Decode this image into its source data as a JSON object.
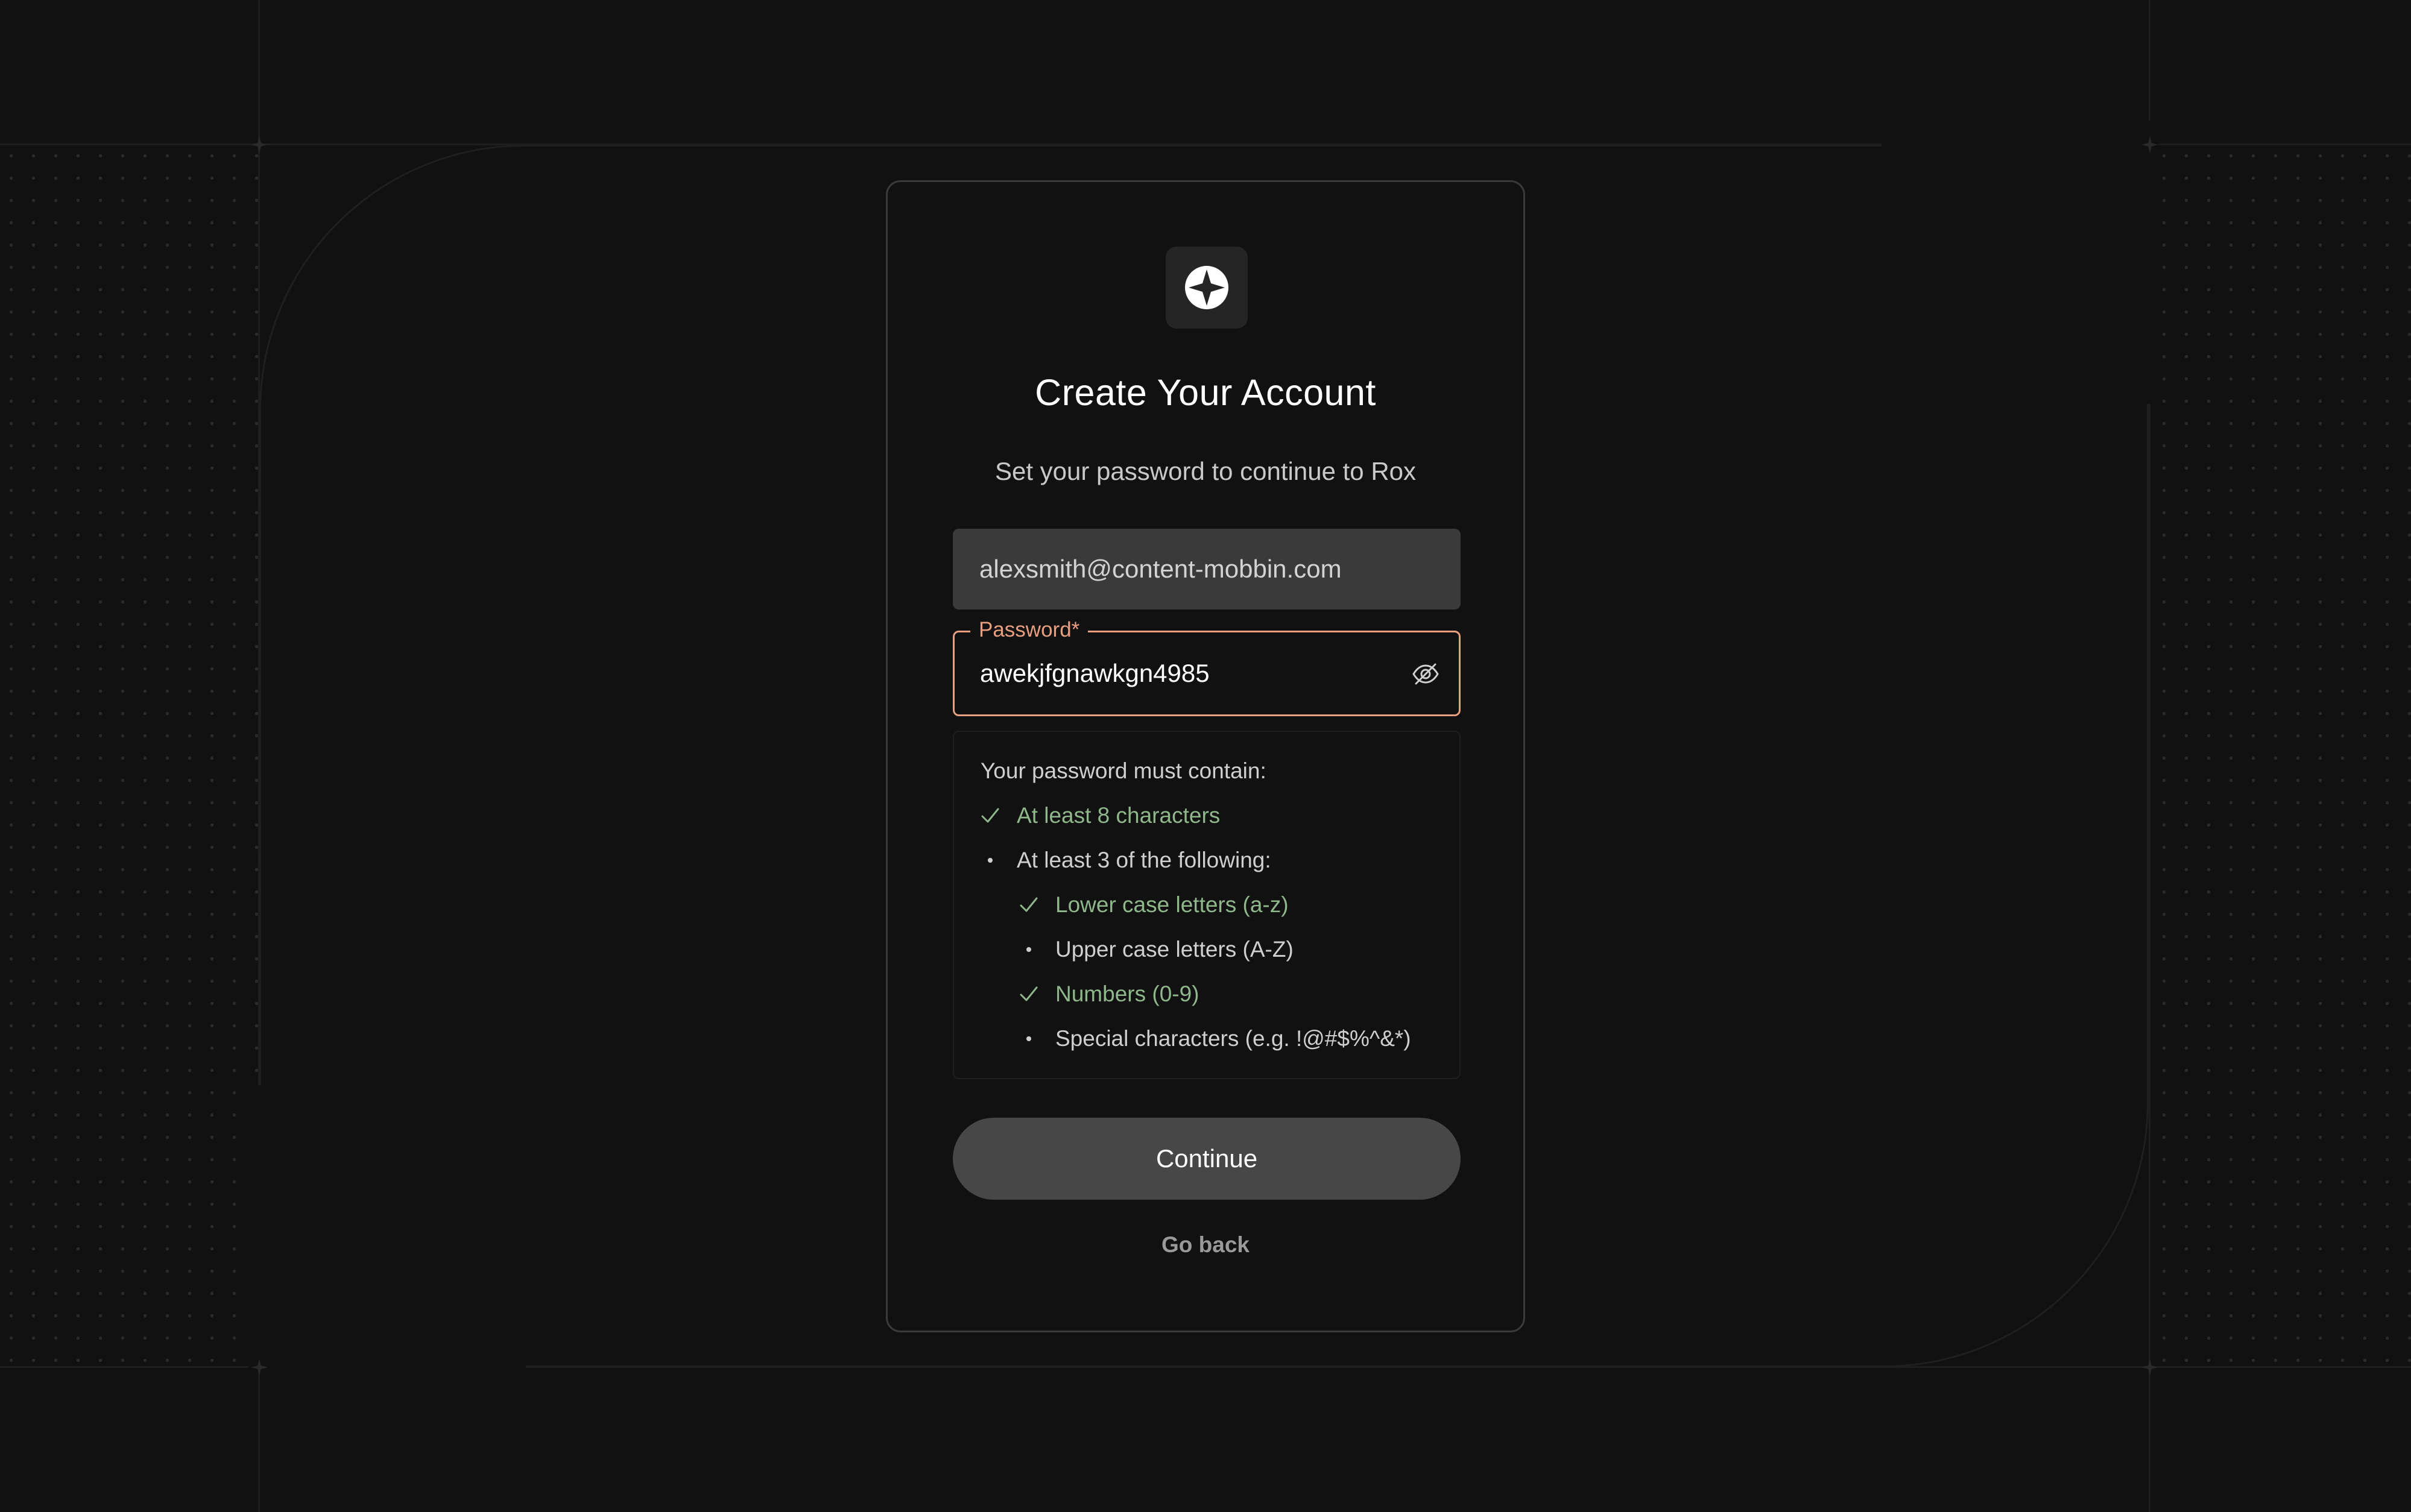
{
  "background": {
    "color": "#111111"
  },
  "card": {
    "logo_icon": "compass-star-icon",
    "title": "Create Your Account",
    "subtitle": "Set your password to continue to Rox",
    "email_value": "alexsmith@content-mobbin.com",
    "password": {
      "label": "Password*",
      "value": "awekjfgnawkgn4985",
      "toggle_icon": "eye-slash-icon",
      "accent_color": "#e89f7f"
    },
    "requirements": {
      "heading": "Your password must contain:",
      "items": [
        {
          "text": "At least 8 characters",
          "status": "met"
        },
        {
          "text": "At least 3 of the following:",
          "status": "pending"
        }
      ],
      "sub_items": [
        {
          "text": "Lower case letters (a-z)",
          "status": "met"
        },
        {
          "text": "Upper case letters (A-Z)",
          "status": "pending"
        },
        {
          "text": "Numbers (0-9)",
          "status": "met"
        },
        {
          "text": "Special characters (e.g. !@#$%^&*)",
          "status": "pending"
        }
      ],
      "met_color": "#8fb78b"
    },
    "continue_label": "Continue",
    "go_back_label": "Go back"
  }
}
